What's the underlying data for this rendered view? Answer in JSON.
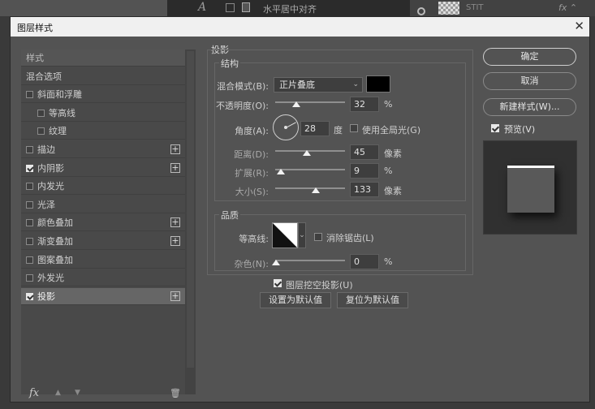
{
  "background": {
    "glyph": "A",
    "text": "水平居中对齐",
    "text2": "STIT",
    "fx": "fx ⌃"
  },
  "dialog": {
    "title": "图层样式",
    "close_label": "✕"
  },
  "styles_list": {
    "header": "样式",
    "items": [
      {
        "label": "混合选项",
        "checkbox": false,
        "checked": false,
        "plus": false
      },
      {
        "label": "斜面和浮雕",
        "checkbox": true,
        "checked": false,
        "plus": false
      },
      {
        "label": "等高线",
        "checkbox": true,
        "checked": false,
        "plus": false,
        "indent": true
      },
      {
        "label": "纹理",
        "checkbox": true,
        "checked": false,
        "plus": false,
        "indent": true
      },
      {
        "label": "描边",
        "checkbox": true,
        "checked": false,
        "plus": true
      },
      {
        "label": "内阴影",
        "checkbox": true,
        "checked": true,
        "plus": true
      },
      {
        "label": "内发光",
        "checkbox": true,
        "checked": false,
        "plus": false
      },
      {
        "label": "光泽",
        "checkbox": true,
        "checked": false,
        "plus": false
      },
      {
        "label": "颜色叠加",
        "checkbox": true,
        "checked": false,
        "plus": true
      },
      {
        "label": "渐变叠加",
        "checkbox": true,
        "checked": false,
        "plus": true
      },
      {
        "label": "图案叠加",
        "checkbox": true,
        "checked": false,
        "plus": false
      },
      {
        "label": "外发光",
        "checkbox": true,
        "checked": false,
        "plus": false
      },
      {
        "label": "投影",
        "checkbox": true,
        "checked": true,
        "plus": true,
        "selected": true
      }
    ],
    "footer": {
      "fx_label": "fx",
      "up_label": "▲",
      "down_label": "▼",
      "trash_label": "🗑"
    }
  },
  "drop_shadow": {
    "section_title": "投影",
    "structure": {
      "title": "结构",
      "blend_mode_label": "混合模式(B):",
      "blend_mode_value": "正片叠底",
      "blend_color": "#000000",
      "opacity_label": "不透明度(O):",
      "opacity_value": "32",
      "opacity_unit": "%",
      "angle_label": "角度(A):",
      "angle_value": "28",
      "angle_unit": "度",
      "global_light_label": "使用全局光(G)",
      "global_light_checked": false,
      "distance_label": "距离(D):",
      "distance_value": "45",
      "distance_unit": "像素",
      "spread_label": "扩展(R):",
      "spread_value": "9",
      "spread_unit": "%",
      "size_label": "大小(S):",
      "size_value": "133",
      "size_unit": "像素"
    },
    "quality": {
      "title": "品质",
      "contour_label": "等高线:",
      "antialias_label": "消除锯齿(L)",
      "antialias_checked": false,
      "noise_label": "杂色(N):",
      "noise_value": "0",
      "noise_unit": "%"
    },
    "knockout_label": "图层挖空投影(U)",
    "knockout_checked": true,
    "make_default_label": "设置为默认值",
    "reset_default_label": "复位为默认值"
  },
  "right_panel": {
    "ok_label": "确定",
    "cancel_label": "取消",
    "new_style_label": "新建样式(W)...",
    "preview_label": "预览(V)",
    "preview_checked": true
  }
}
